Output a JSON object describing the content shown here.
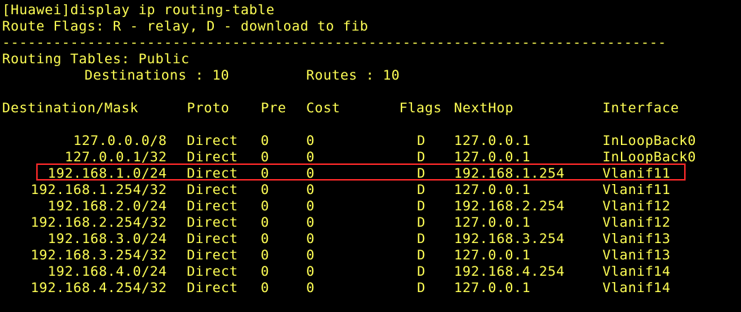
{
  "terminal": {
    "command_line": "[Huawei]display ip routing-table",
    "route_flags_line": "Route Flags: R - relay, D - download to fib",
    "separator_line": "------------------------------------------------------------------------------",
    "routing_tables_line": "Routing Tables: Public",
    "destinations_label": "Destinations : 10",
    "routes_label": "Routes : 10"
  },
  "table": {
    "headers": {
      "destination_mask": "Destination/Mask",
      "proto": "Proto",
      "pre": "Pre",
      "cost": "Cost",
      "flags": "Flags",
      "nexthop": "NextHop",
      "interface": "Interface"
    },
    "rows": [
      {
        "destination": "127.0.0.0/8",
        "proto": "Direct",
        "pre": "0",
        "cost": "0",
        "flags": "D",
        "nexthop": "127.0.0.1",
        "interface": "InLoopBack0"
      },
      {
        "destination": "127.0.0.1/32",
        "proto": "Direct",
        "pre": "0",
        "cost": "0",
        "flags": "D",
        "nexthop": "127.0.0.1",
        "interface": "InLoopBack0"
      },
      {
        "destination": "192.168.1.0/24",
        "proto": "Direct",
        "pre": "0",
        "cost": "0",
        "flags": "D",
        "nexthop": "192.168.1.254",
        "interface": "Vlanif11"
      },
      {
        "destination": "192.168.1.254/32",
        "proto": "Direct",
        "pre": "0",
        "cost": "0",
        "flags": "D",
        "nexthop": "127.0.0.1",
        "interface": "Vlanif11"
      },
      {
        "destination": "192.168.2.0/24",
        "proto": "Direct",
        "pre": "0",
        "cost": "0",
        "flags": "D",
        "nexthop": "192.168.2.254",
        "interface": "Vlanif12"
      },
      {
        "destination": "192.168.2.254/32",
        "proto": "Direct",
        "pre": "0",
        "cost": "0",
        "flags": "D",
        "nexthop": "127.0.0.1",
        "interface": "Vlanif12"
      },
      {
        "destination": "192.168.3.0/24",
        "proto": "Direct",
        "pre": "0",
        "cost": "0",
        "flags": "D",
        "nexthop": "192.168.3.254",
        "interface": "Vlanif13"
      },
      {
        "destination": "192.168.3.254/32",
        "proto": "Direct",
        "pre": "0",
        "cost": "0",
        "flags": "D",
        "nexthop": "127.0.0.1",
        "interface": "Vlanif13"
      },
      {
        "destination": "192.168.4.0/24",
        "proto": "Direct",
        "pre": "0",
        "cost": "0",
        "flags": "D",
        "nexthop": "192.168.4.254",
        "interface": "Vlanif14"
      },
      {
        "destination": "192.168.4.254/32",
        "proto": "Direct",
        "pre": "0",
        "cost": "0",
        "flags": "D",
        "nexthop": "127.0.0.1",
        "interface": "Vlanif14"
      }
    ]
  },
  "colors": {
    "background": "#000000",
    "text": "#ffff55",
    "highlight_border": "#ff2a2a"
  }
}
